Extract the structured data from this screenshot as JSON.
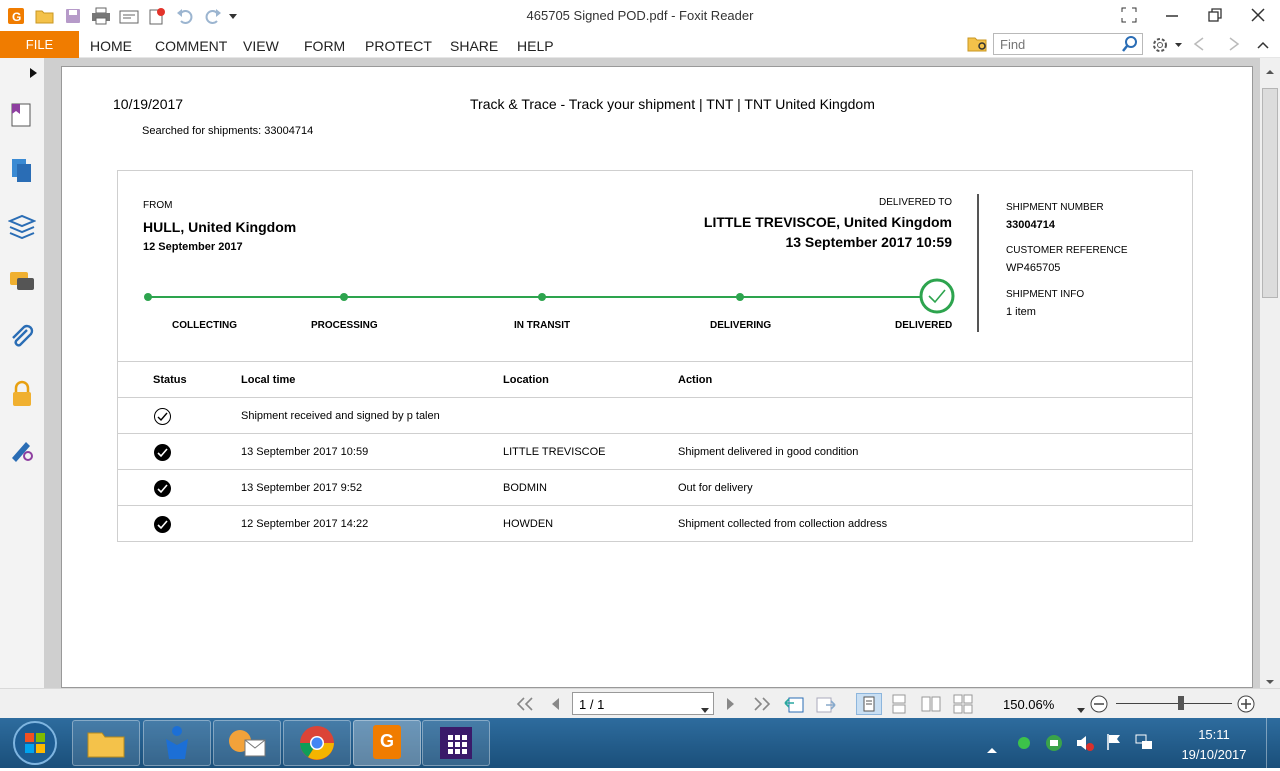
{
  "window": {
    "title": "465705 Signed POD.pdf - Foxit Reader"
  },
  "menu": {
    "file": "FILE",
    "items": [
      "HOME",
      "COMMENT",
      "VIEW",
      "FORM",
      "PROTECT",
      "SHARE",
      "HELP"
    ],
    "find_placeholder": "Find"
  },
  "doc": {
    "date": "10/19/2017",
    "header_title": "Track & Trace - Track your shipment | TNT | TNT United Kingdom",
    "searched": "Searched for shipments: 33004714",
    "from_label": "FROM",
    "from_place": "HULL, United Kingdom",
    "from_date": "12 September 2017",
    "delivered_label": "DELIVERED TO",
    "delivered_place": "LITTLE TREVISCOE, United Kingdom",
    "delivered_date": "13 September 2017 10:59",
    "steps": [
      "COLLECTING",
      "PROCESSING",
      "IN TRANSIT",
      "DELIVERING",
      "DELIVERED"
    ],
    "shipment_number_label": "SHIPMENT NUMBER",
    "shipment_number": "33004714",
    "customer_ref_label": "CUSTOMER REFERENCE",
    "customer_ref": "WP465705",
    "shipment_info_label": "SHIPMENT INFO",
    "shipment_info": "1 item",
    "table": {
      "headers": [
        "Status",
        "Local time",
        "Location",
        "Action"
      ],
      "rows": [
        {
          "status": "outline",
          "time": "Shipment received and signed by p talen",
          "location": "",
          "action": ""
        },
        {
          "status": "filled",
          "time": "13 September 2017 10:59",
          "location": "LITTLE TREVISCOE",
          "action": "Shipment delivered in good condition"
        },
        {
          "status": "filled",
          "time": "13 September 2017 9:52",
          "location": "BODMIN",
          "action": "Out for delivery"
        },
        {
          "status": "filled",
          "time": "12 September 2017 14:22",
          "location": "HOWDEN",
          "action": "Shipment collected from collection address"
        }
      ]
    }
  },
  "status": {
    "page": "1 / 1",
    "zoom": "150.06%"
  },
  "taskbar": {
    "time": "15:11",
    "date": "19/10/2017"
  },
  "colors": {
    "accent": "#f07c00",
    "progress": "#2da44e"
  }
}
